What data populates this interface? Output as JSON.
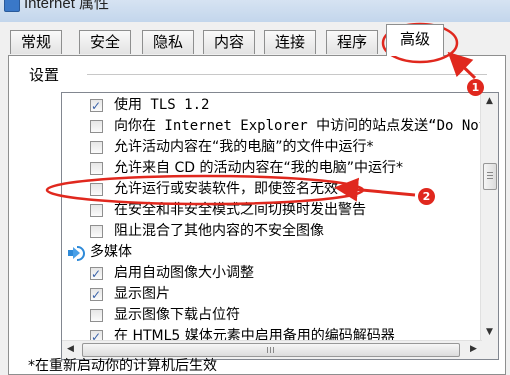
{
  "window": {
    "title": "Internet 属性"
  },
  "tabs": [
    {
      "label": "常规"
    },
    {
      "label": "安全"
    },
    {
      "label": "隐私"
    },
    {
      "label": "内容"
    },
    {
      "label": "连接"
    },
    {
      "label": "程序"
    },
    {
      "label": "高级",
      "active": true
    }
  ],
  "settings": {
    "section_label": "设置",
    "rows": [
      {
        "type": "checkbox",
        "checked": true,
        "text": "使用 TLS 1.2"
      },
      {
        "type": "checkbox",
        "checked": false,
        "text": "向你在 Internet Explorer 中访问的站点发送“Do Not Track”请求"
      },
      {
        "type": "checkbox",
        "checked": false,
        "text": "允许活动内容在“我的电脑”的文件中运行*"
      },
      {
        "type": "checkbox",
        "checked": false,
        "text": "允许来自 CD 的活动内容在“我的电脑”中运行*"
      },
      {
        "type": "checkbox",
        "checked": false,
        "text": "允许运行或安装软件，即使签名无效"
      },
      {
        "type": "checkbox",
        "checked": false,
        "text": "在安全和非安全模式之间切换时发出警告"
      },
      {
        "type": "checkbox",
        "checked": false,
        "text": "阻止混合了其他内容的不安全图像"
      },
      {
        "type": "category",
        "icon": "multimedia-icon",
        "text": "多媒体"
      },
      {
        "type": "checkbox",
        "checked": true,
        "text": "启用自动图像大小调整"
      },
      {
        "type": "checkbox",
        "checked": true,
        "text": "显示图片"
      },
      {
        "type": "checkbox",
        "checked": false,
        "text": "显示图像下载占位符"
      },
      {
        "type": "checkbox",
        "checked": true,
        "text": "在 HTML5 媒体元素中启用备用的编码解码器"
      }
    ]
  },
  "footnote": "*在重新启动你的计算机后生效",
  "annotations": [
    {
      "label": "1"
    },
    {
      "label": "2"
    }
  ],
  "colors": {
    "annotation": "#e0281e",
    "checkmark": "#3a62a8",
    "panel_border": "#8e8f8f"
  }
}
